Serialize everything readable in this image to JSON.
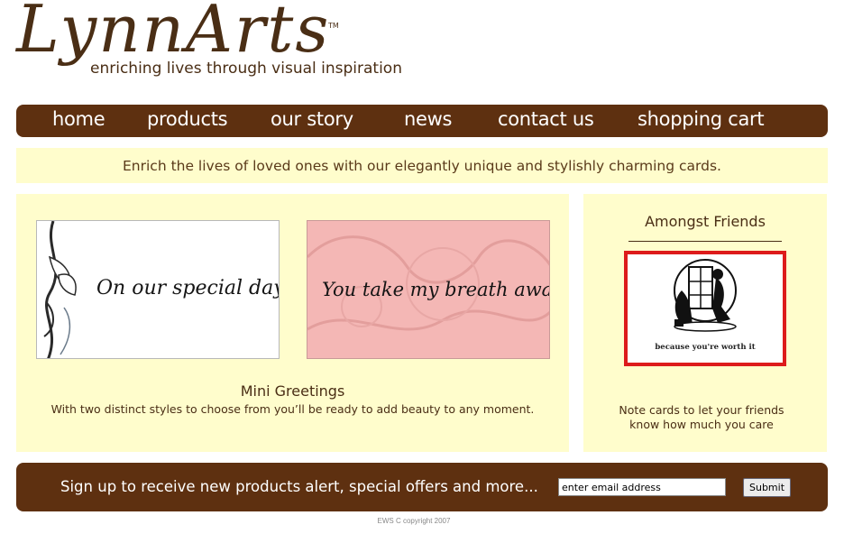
{
  "logo": {
    "name": "LynnArts",
    "trademark": "TM",
    "tagline": "enriching lives through visual inspiration"
  },
  "nav": {
    "items": [
      {
        "label": "home"
      },
      {
        "label": "products"
      },
      {
        "label": "our story"
      },
      {
        "label": "news"
      },
      {
        "label": "contact us"
      },
      {
        "label": "shopping cart"
      }
    ]
  },
  "banner": {
    "text": "Enrich the lives of loved ones with our elegantly unique and stylishly charming cards."
  },
  "featured": {
    "cards": [
      {
        "script": "On our special day"
      },
      {
        "script": "You take my breath away"
      }
    ],
    "title": "Mini Greetings",
    "description": "With two distinct styles to choose from you’ll be ready to add beauty to any moment."
  },
  "side": {
    "title": "Amongst Friends",
    "card_caption": "because you're worth it",
    "description_line1": "Note cards to let your friends",
    "description_line2": "know how much you care"
  },
  "signup": {
    "text": "Sign up to receive new products alert, special offers and more...",
    "email_value": "enter email address",
    "submit_label": "Submit"
  },
  "footer": {
    "copyright": "EWS C copyright 2007"
  },
  "colors": {
    "brown": "#5e3010",
    "cream": "#fffdcc",
    "pink": "#f4b7b5",
    "red_border": "#dd1b1b"
  }
}
